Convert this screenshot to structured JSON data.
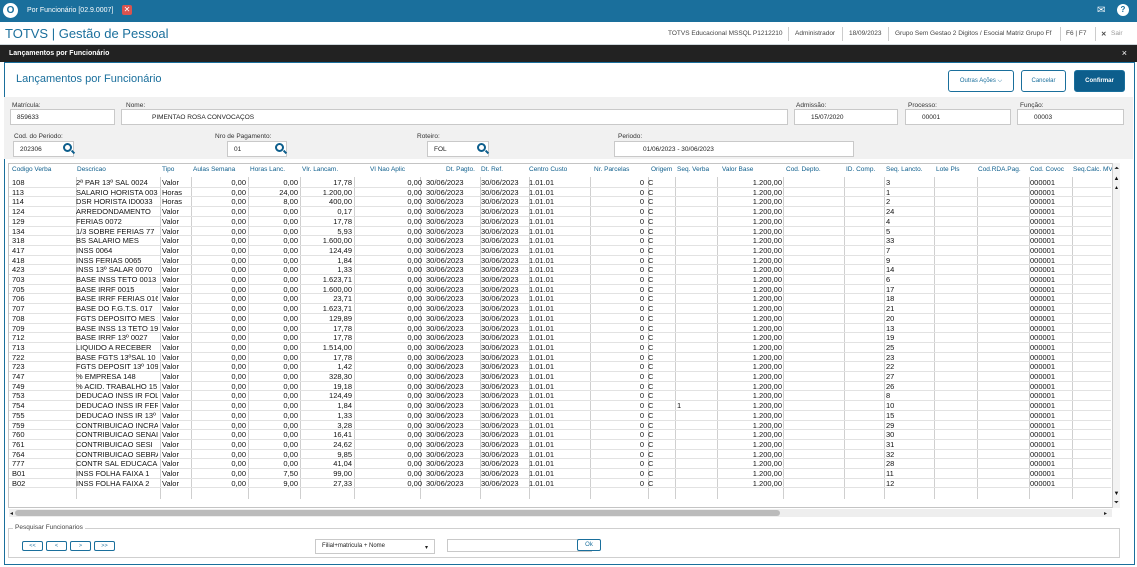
{
  "window": {
    "title": "Por Funcionário [02.9.0007]",
    "icons": {
      "logo": "totvs-logo",
      "close": "close-icon",
      "mail": "mail-icon",
      "help": "help-icon"
    }
  },
  "app": {
    "title": "TOTVS | Gestão de Pessoal",
    "info": [
      "TOTVS Educacional MSSQL P1212210",
      "Administrador",
      "18/09/2023",
      "Grupo Sem Gestao 2 Digitos / Esocial Matriz Grupo Ff",
      "F6 | F7"
    ],
    "exit_label": "Sair"
  },
  "dialog": {
    "title": "Lançamentos por Funcionário"
  },
  "page": {
    "title": "Lançamentos por Funcionário",
    "actions": {
      "outras": "Outras Ações",
      "cancel": "Cancelar",
      "confirm": "Confirmar"
    }
  },
  "header": {
    "matricula": {
      "label": "Matrícula:",
      "value": "859633"
    },
    "nome": {
      "label": "Nome:",
      "value": "PIMENTAO ROSA CONVOCAÇOS"
    },
    "admissao": {
      "label": "Admissão:",
      "value": "15/07/2020"
    },
    "processo": {
      "label": "Processo:",
      "value": "00001"
    },
    "funcao": {
      "label": "Função:",
      "value": "00003"
    }
  },
  "filters": {
    "periodo_cod": {
      "label": "Cod. do Periodo:",
      "value": "202306"
    },
    "nro_pagamento": {
      "label": "Nro de Pagamento:",
      "value": "01"
    },
    "roteiro": {
      "label": "Roteiro:",
      "value": "FOL"
    },
    "periodo": {
      "label": "Periodo:",
      "value": "01/06/2023 - 30/06/2023"
    }
  },
  "table": {
    "columns": [
      "Codigo Verba",
      "Descricao",
      "Tipo",
      "Aulas Semana",
      "Horas Lanc.",
      "Vlr. Lancam.",
      "Vl Nao Aplic",
      "Dt. Pagto.",
      "Dt. Ref.",
      "Centro Custo",
      "Nr. Parcelas",
      "Origem",
      "Seq. Verba",
      "Valor Base",
      "Cod. Depto.",
      "ID. Comp.",
      "Seq. Lancto.",
      "Lote Pls",
      "Cod.RDA.Pag.",
      "Cod. Covoc",
      "Seq.Calc. MV"
    ],
    "rows": [
      [
        "108",
        "2ª PAR 13º SAL 0024",
        "Valor",
        "0,00",
        "0,00",
        "17,78",
        "0,00",
        "30/06/2023",
        "30/06/2023",
        "1.01.01",
        "0",
        "C",
        "",
        "1.200,00",
        "",
        "",
        "3",
        "",
        "",
        "000001",
        ""
      ],
      [
        "113",
        "SALARIO HORISTA 003",
        "Horas",
        "0,00",
        "24,00",
        "1.200,00",
        "0,00",
        "30/06/2023",
        "30/06/2023",
        "1.01.01",
        "0",
        "C",
        "",
        "1.200,00",
        "",
        "",
        "1",
        "",
        "",
        "000001",
        ""
      ],
      [
        "114",
        "DSR HORISTA ID0033",
        "Horas",
        "0,00",
        "8,00",
        "400,00",
        "0,00",
        "30/06/2023",
        "30/06/2023",
        "1.01.01",
        "0",
        "C",
        "",
        "1.200,00",
        "",
        "",
        "2",
        "",
        "",
        "000001",
        ""
      ],
      [
        "124",
        "ARREDONDAMENTO",
        "Valor",
        "0,00",
        "0,00",
        "0,17",
        "0,00",
        "30/06/2023",
        "30/06/2023",
        "1.01.01",
        "0",
        "C",
        "",
        "1.200,00",
        "",
        "",
        "24",
        "",
        "",
        "000001",
        ""
      ],
      [
        "129",
        "FERIAS 0072",
        "Valor",
        "0,00",
        "0,00",
        "17,78",
        "0,00",
        "30/06/2023",
        "30/06/2023",
        "1.01.01",
        "0",
        "C",
        "",
        "1.200,00",
        "",
        "",
        "4",
        "",
        "",
        "000001",
        ""
      ],
      [
        "134",
        "1/3 SOBRE FERIAS 77",
        "Valor",
        "0,00",
        "0,00",
        "5,93",
        "0,00",
        "30/06/2023",
        "30/06/2023",
        "1.01.01",
        "0",
        "C",
        "",
        "1.200,00",
        "",
        "",
        "5",
        "",
        "",
        "000001",
        ""
      ],
      [
        "318",
        "BS SALARIO MES",
        "Valor",
        "0,00",
        "0,00",
        "1.600,00",
        "0,00",
        "30/06/2023",
        "30/06/2023",
        "1.01.01",
        "0",
        "C",
        "",
        "1.200,00",
        "",
        "",
        "33",
        "",
        "",
        "000001",
        ""
      ],
      [
        "417",
        "INSS 0064",
        "Valor",
        "0,00",
        "0,00",
        "124,49",
        "0,00",
        "30/06/2023",
        "30/06/2023",
        "1.01.01",
        "0",
        "C",
        "",
        "1.200,00",
        "",
        "",
        "7",
        "",
        "",
        "000001",
        ""
      ],
      [
        "418",
        "INSS FERIAS 0065",
        "Valor",
        "0,00",
        "0,00",
        "1,84",
        "0,00",
        "30/06/2023",
        "30/06/2023",
        "1.01.01",
        "0",
        "C",
        "",
        "1.200,00",
        "",
        "",
        "9",
        "",
        "",
        "000001",
        ""
      ],
      [
        "423",
        "INSS 13º SALAR 0070",
        "Valor",
        "0,00",
        "0,00",
        "1,33",
        "0,00",
        "30/06/2023",
        "30/06/2023",
        "1.01.01",
        "0",
        "C",
        "",
        "1.200,00",
        "",
        "",
        "14",
        "",
        "",
        "000001",
        ""
      ],
      [
        "703",
        "BASE INSS TETO 0013",
        "Valor",
        "0,00",
        "0,00",
        "1.623,71",
        "0,00",
        "30/06/2023",
        "30/06/2023",
        "1.01.01",
        "0",
        "C",
        "",
        "1.200,00",
        "",
        "",
        "6",
        "",
        "",
        "000001",
        ""
      ],
      [
        "705",
        "BASE IRRF 0015",
        "Valor",
        "0,00",
        "0,00",
        "1.600,00",
        "0,00",
        "30/06/2023",
        "30/06/2023",
        "1.01.01",
        "0",
        "C",
        "",
        "1.200,00",
        "",
        "",
        "17",
        "",
        "",
        "000001",
        ""
      ],
      [
        "706",
        "BASE IRRF FERIAS 016",
        "Valor",
        "0,00",
        "0,00",
        "23,71",
        "0,00",
        "30/06/2023",
        "30/06/2023",
        "1.01.01",
        "0",
        "C",
        "",
        "1.200,00",
        "",
        "",
        "18",
        "",
        "",
        "000001",
        ""
      ],
      [
        "707",
        "BASE DO F.G.T.S. 017",
        "Valor",
        "0,00",
        "0,00",
        "1.623,71",
        "0,00",
        "30/06/2023",
        "30/06/2023",
        "1.01.01",
        "0",
        "C",
        "",
        "1.200,00",
        "",
        "",
        "21",
        "",
        "",
        "000001",
        ""
      ],
      [
        "708",
        "FGTS DEPOSITO MES 1",
        "Valor",
        "0,00",
        "0,00",
        "129,89",
        "0,00",
        "30/06/2023",
        "30/06/2023",
        "1.01.01",
        "0",
        "C",
        "",
        "1.200,00",
        "",
        "",
        "20",
        "",
        "",
        "000001",
        ""
      ],
      [
        "709",
        "BASE INSS 13 TETO 19",
        "Valor",
        "0,00",
        "0,00",
        "17,78",
        "0,00",
        "30/06/2023",
        "30/06/2023",
        "1.01.01",
        "0",
        "C",
        "",
        "1.200,00",
        "",
        "",
        "13",
        "",
        "",
        "000001",
        ""
      ],
      [
        "712",
        "BASE IRRF 13º 0027",
        "Valor",
        "0,00",
        "0,00",
        "17,78",
        "0,00",
        "30/06/2023",
        "30/06/2023",
        "1.01.01",
        "0",
        "C",
        "",
        "1.200,00",
        "",
        "",
        "19",
        "",
        "",
        "000001",
        ""
      ],
      [
        "713",
        "LIQUIDO A RECEBER",
        "Valor",
        "0,00",
        "0,00",
        "1.514,00",
        "0,00",
        "30/06/2023",
        "30/06/2023",
        "1.01.01",
        "0",
        "C",
        "",
        "1.200,00",
        "",
        "",
        "25",
        "",
        "",
        "000001",
        ""
      ],
      [
        "722",
        "BASE FGTS 13ºSAL 10",
        "Valor",
        "0,00",
        "0,00",
        "17,78",
        "0,00",
        "30/06/2023",
        "30/06/2023",
        "1.01.01",
        "0",
        "C",
        "",
        "1.200,00",
        "",
        "",
        "23",
        "",
        "",
        "000001",
        ""
      ],
      [
        "723",
        "FGTS DEPOSIT 13º 109",
        "Valor",
        "0,00",
        "0,00",
        "1,42",
        "0,00",
        "30/06/2023",
        "30/06/2023",
        "1.01.01",
        "0",
        "C",
        "",
        "1.200,00",
        "",
        "",
        "22",
        "",
        "",
        "000001",
        ""
      ],
      [
        "747",
        "% EMPRESA 148",
        "Valor",
        "0,00",
        "0,00",
        "328,30",
        "0,00",
        "30/06/2023",
        "30/06/2023",
        "1.01.01",
        "0",
        "C",
        "",
        "1.200,00",
        "",
        "",
        "27",
        "",
        "",
        "000001",
        ""
      ],
      [
        "749",
        "% ACID. TRABALHO 15",
        "Valor",
        "0,00",
        "0,00",
        "19,18",
        "0,00",
        "30/06/2023",
        "30/06/2023",
        "1.01.01",
        "0",
        "C",
        "",
        "1.200,00",
        "",
        "",
        "26",
        "",
        "",
        "000001",
        ""
      ],
      [
        "753",
        "DEDUCAO INSS IR FOL",
        "Valor",
        "0,00",
        "0,00",
        "124,49",
        "0,00",
        "30/06/2023",
        "30/06/2023",
        "1.01.01",
        "0",
        "C",
        "",
        "1.200,00",
        "",
        "",
        "8",
        "",
        "",
        "000001",
        ""
      ],
      [
        "754",
        "DEDUCAO INSS IR FER",
        "Valor",
        "0,00",
        "0,00",
        "1,84",
        "0,00",
        "30/06/2023",
        "30/06/2023",
        "1.01.01",
        "0",
        "C",
        "1",
        "1.200,00",
        "",
        "",
        "10",
        "",
        "",
        "000001",
        ""
      ],
      [
        "755",
        "DEDUCAO INSS IR 13º",
        "Valor",
        "0,00",
        "0,00",
        "1,33",
        "0,00",
        "30/06/2023",
        "30/06/2023",
        "1.01.01",
        "0",
        "C",
        "",
        "1.200,00",
        "",
        "",
        "15",
        "",
        "",
        "000001",
        ""
      ],
      [
        "759",
        "CONTRIBUICAO INCRA",
        "Valor",
        "0,00",
        "0,00",
        "3,28",
        "0,00",
        "30/06/2023",
        "30/06/2023",
        "1.01.01",
        "0",
        "C",
        "",
        "1.200,00",
        "",
        "",
        "29",
        "",
        "",
        "000001",
        ""
      ],
      [
        "760",
        "CONTRIBUICAO SENAI",
        "Valor",
        "0,00",
        "0,00",
        "16,41",
        "0,00",
        "30/06/2023",
        "30/06/2023",
        "1.01.01",
        "0",
        "C",
        "",
        "1.200,00",
        "",
        "",
        "30",
        "",
        "",
        "000001",
        ""
      ],
      [
        "761",
        "CONTRIBUICAO SESI",
        "Valor",
        "0,00",
        "0,00",
        "24,62",
        "0,00",
        "30/06/2023",
        "30/06/2023",
        "1.01.01",
        "0",
        "C",
        "",
        "1.200,00",
        "",
        "",
        "31",
        "",
        "",
        "000001",
        ""
      ],
      [
        "764",
        "CONTRIBUICAO SEBRA",
        "Valor",
        "0,00",
        "0,00",
        "9,85",
        "0,00",
        "30/06/2023",
        "30/06/2023",
        "1.01.01",
        "0",
        "C",
        "",
        "1.200,00",
        "",
        "",
        "32",
        "",
        "",
        "000001",
        ""
      ],
      [
        "777",
        "CONTR SAL EDUCACA",
        "Valor",
        "0,00",
        "0,00",
        "41,04",
        "0,00",
        "30/06/2023",
        "30/06/2023",
        "1.01.01",
        "0",
        "C",
        "",
        "1.200,00",
        "",
        "",
        "28",
        "",
        "",
        "000001",
        ""
      ],
      [
        "B01",
        "INSS FOLHA FAIXA 1",
        "Valor",
        "0,00",
        "7,50",
        "99,00",
        "0,00",
        "30/06/2023",
        "30/06/2023",
        "1.01.01",
        "0",
        "C",
        "",
        "1.200,00",
        "",
        "",
        "11",
        "",
        "",
        "000001",
        ""
      ],
      [
        "B02",
        "INSS FOLHA FAIXA 2",
        "Valor",
        "0,00",
        "9,00",
        "27,33",
        "0,00",
        "30/06/2023",
        "30/06/2023",
        "1.01.01",
        "0",
        "C",
        "",
        "1.200,00",
        "",
        "",
        "12",
        "",
        "",
        "000001",
        ""
      ]
    ]
  },
  "search": {
    "title": "Pesquisar Funcionarios",
    "nav": [
      "<<",
      "<",
      ">",
      ">>"
    ],
    "order": "Filial+matricula + Nome",
    "ok": "Ok"
  }
}
